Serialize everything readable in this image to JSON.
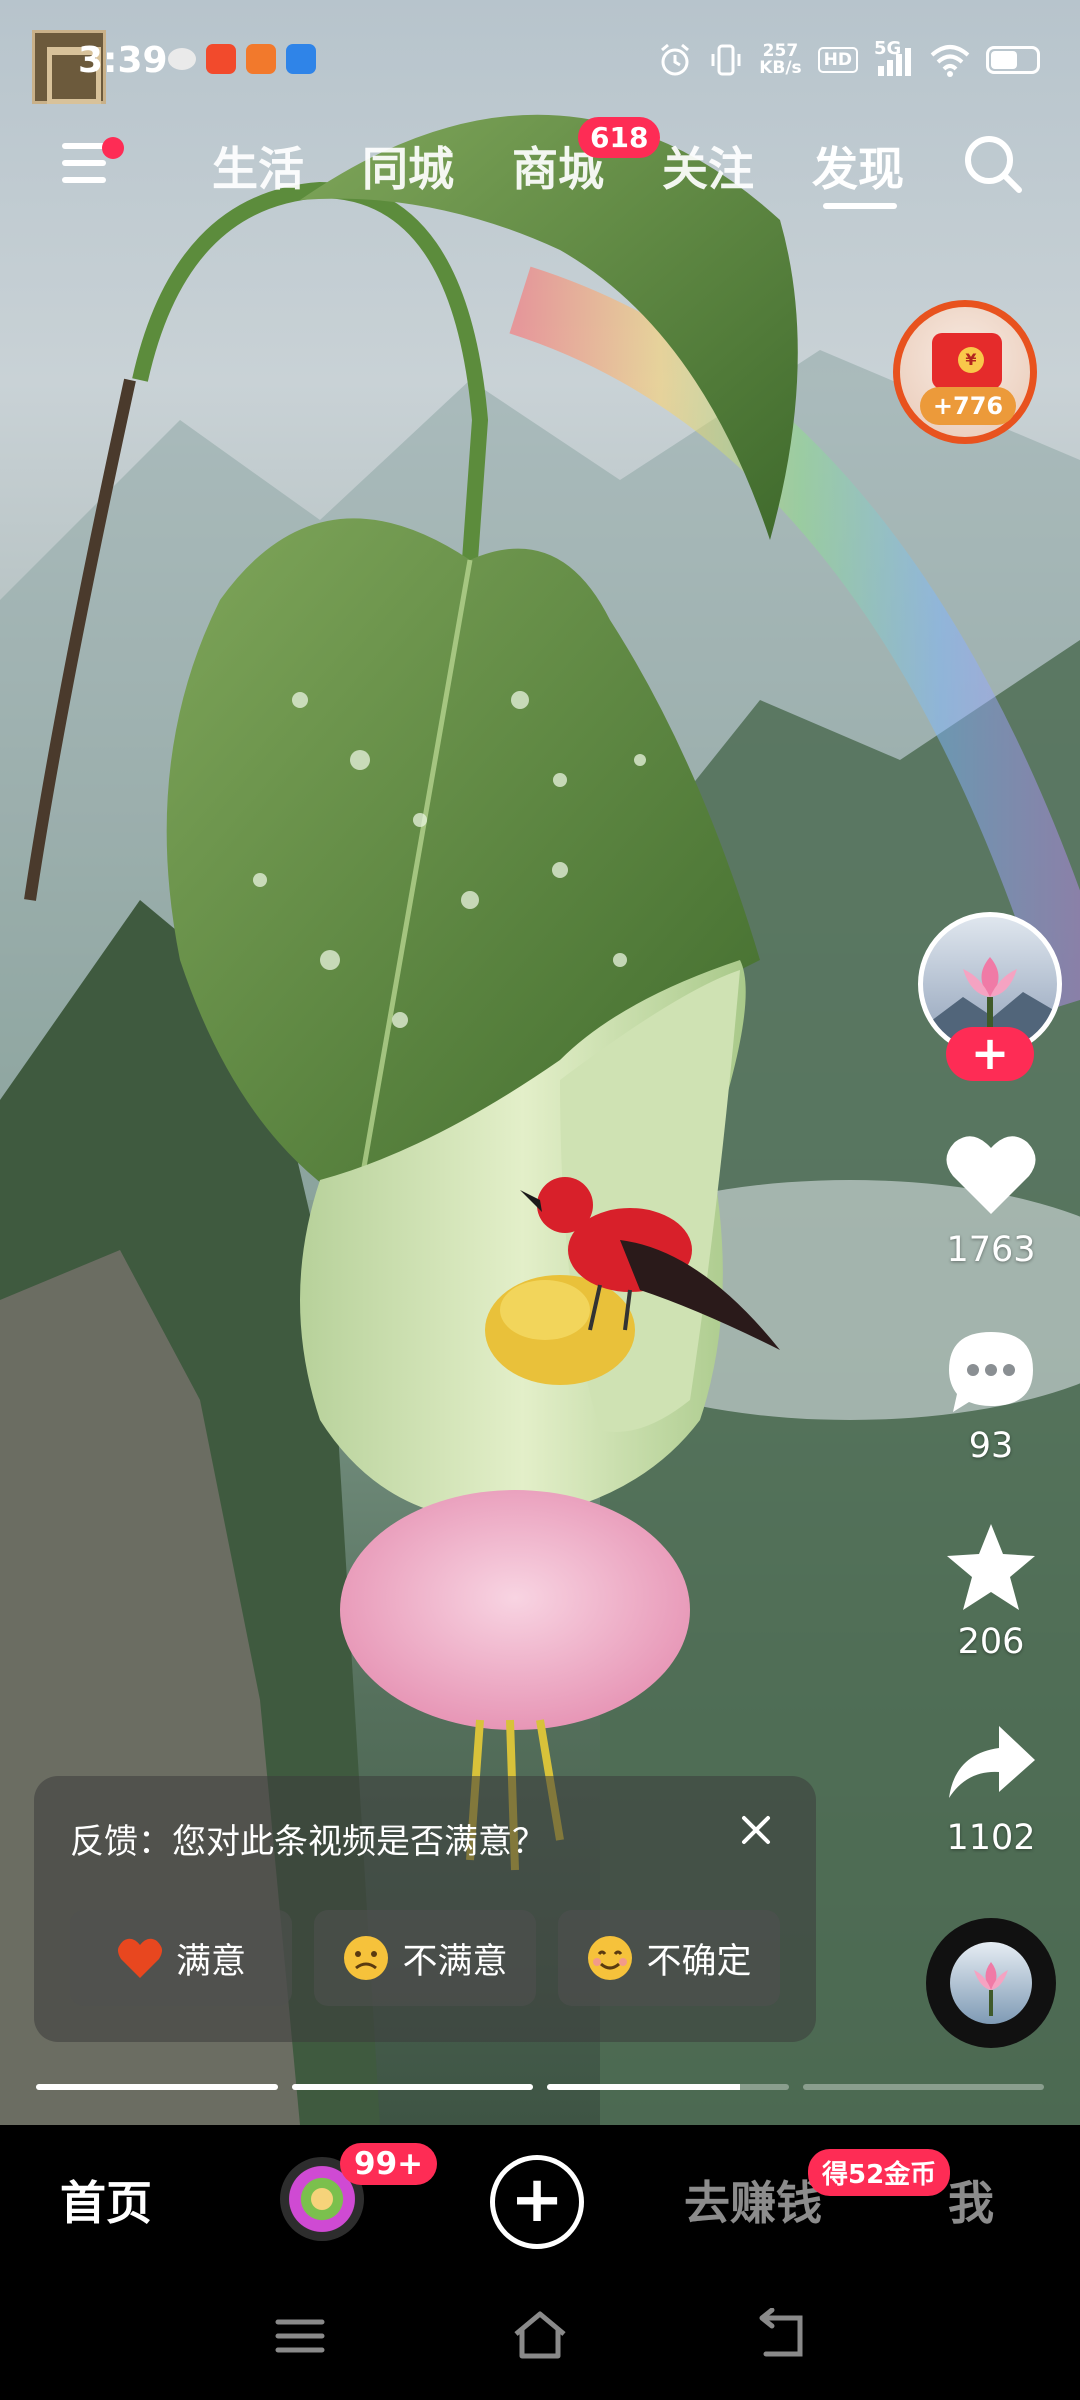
{
  "status_bar": {
    "time": "3:39",
    "net_speed_value": "257",
    "net_speed_unit": "KB/s",
    "hd_label": "HD",
    "signal_label": "5G",
    "battery_level": 0.55,
    "icons": [
      "leaf-icon",
      "red-app-icon",
      "shopping-app-icon",
      "blue-app-icon",
      "alarm-icon",
      "vibrate-icon",
      "wifi-icon",
      "battery-icon"
    ]
  },
  "top_nav": {
    "menu_has_dot": true,
    "tabs": [
      {
        "label": "生活"
      },
      {
        "label": "同城"
      },
      {
        "label": "商城",
        "badge": "618"
      },
      {
        "label": "关注"
      },
      {
        "label": "发现",
        "active": true
      }
    ]
  },
  "red_packet": {
    "coin_symbol": "¥",
    "amount": "+776"
  },
  "actions": {
    "likes": "1763",
    "comments": "93",
    "favorites": "206",
    "shares": "1102"
  },
  "follow_label": "+",
  "feedback": {
    "question": "反馈：您对此条视频是否满意？",
    "options": [
      {
        "label": "满意",
        "emoji": "heart"
      },
      {
        "label": "不满意",
        "emoji": "frown"
      },
      {
        "label": "不确定",
        "emoji": "smile"
      }
    ]
  },
  "progress": {
    "segments": [
      1.0,
      1.0,
      0.8,
      0.0
    ]
  },
  "bottom_bar": {
    "home_label": "首页",
    "friend_badge": "99+",
    "plus_label": "+",
    "earn_label": "去赚钱",
    "earn_badge": "得52金币",
    "me_label": "我"
  },
  "colors": {
    "accent": "#fe2c55",
    "red_packet_ring": "#e8521e",
    "bird": "#d8202a"
  }
}
